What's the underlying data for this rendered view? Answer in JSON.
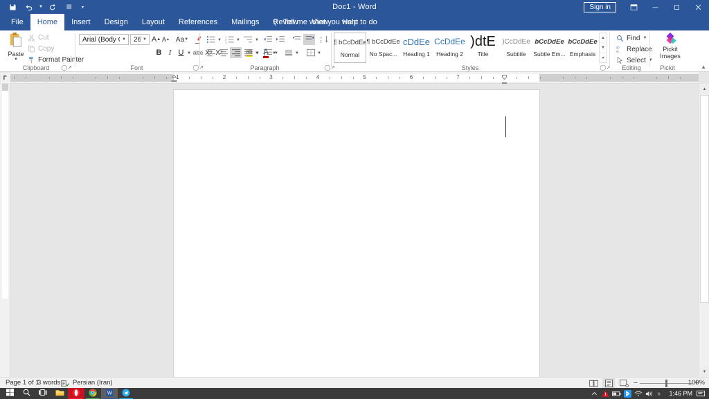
{
  "titlebar": {
    "document_title": "Doc1  -  Word",
    "signin_label": "Sign in",
    "quick_access": [
      {
        "name": "save-icon",
        "tip": "Save"
      },
      {
        "name": "undo-icon",
        "tip": "Undo"
      },
      {
        "name": "redo-icon",
        "tip": "Redo"
      },
      {
        "name": "touch-mode-icon",
        "tip": "Touch/Mouse Mode"
      },
      {
        "name": "customize-qat-icon",
        "tip": "Customize Quick Access Toolbar"
      }
    ],
    "window_buttons": [
      {
        "name": "ribbon-display-options-icon",
        "glyph": "⬚"
      },
      {
        "name": "minimize-icon",
        "glyph": "─"
      },
      {
        "name": "restore-icon",
        "glyph": "❐"
      },
      {
        "name": "close-icon",
        "glyph": "✕"
      }
    ],
    "share_label": "Share"
  },
  "ribbon": {
    "tabs": [
      {
        "label": "File",
        "active": false
      },
      {
        "label": "Home",
        "active": true
      },
      {
        "label": "Insert",
        "active": false
      },
      {
        "label": "Design",
        "active": false
      },
      {
        "label": "Layout",
        "active": false
      },
      {
        "label": "References",
        "active": false
      },
      {
        "label": "Mailings",
        "active": false
      },
      {
        "label": "Review",
        "active": false
      },
      {
        "label": "View",
        "active": false
      },
      {
        "label": "Help",
        "active": false
      }
    ],
    "tell_me": "Tell me what you want to do",
    "groups": {
      "clipboard": {
        "label": "Clipboard",
        "paste_label": "Paste",
        "items": [
          {
            "label": "Cut",
            "icon": "scissors-icon",
            "disabled": true
          },
          {
            "label": "Copy",
            "icon": "copy-icon",
            "disabled": true
          },
          {
            "label": "Format Painter",
            "icon": "format-painter-icon",
            "disabled": false
          }
        ]
      },
      "font": {
        "label": "Font",
        "font_name": "Arial (Body CS)",
        "font_size": "26",
        "row1": [
          {
            "name": "grow-font-button",
            "label": "A"
          },
          {
            "name": "shrink-font-button",
            "label": "A"
          },
          {
            "name": "change-case-button",
            "label": "Aa"
          },
          {
            "name": "clear-formatting-button",
            "label": "clear-formatting-icon"
          }
        ],
        "row2": [
          {
            "name": "bold-button",
            "label": "B"
          },
          {
            "name": "italic-button",
            "label": "I"
          },
          {
            "name": "underline-button",
            "label": "U"
          },
          {
            "name": "strikethrough-button",
            "label": "abc"
          },
          {
            "name": "subscript-button",
            "label": "X₂"
          },
          {
            "name": "superscript-button",
            "label": "X²"
          },
          {
            "name": "text-effects-button",
            "label": "A"
          },
          {
            "name": "text-highlight-color-button",
            "label": "ab"
          },
          {
            "name": "font-color-button",
            "label": "A"
          }
        ]
      },
      "paragraph": {
        "label": "Paragraph",
        "row1": [
          {
            "name": "bullets-button",
            "icon": "bullet-list-icon"
          },
          {
            "name": "numbering-button",
            "icon": "numbered-list-icon"
          },
          {
            "name": "multilevel-list-button",
            "icon": "multilevel-list-icon"
          },
          {
            "name": "decrease-indent-button",
            "icon": "decrease-indent-icon"
          },
          {
            "name": "increase-indent-button",
            "icon": "increase-indent-icon"
          },
          {
            "name": "ltr-text-direction-button",
            "icon": "ltr-icon",
            "active": false
          },
          {
            "name": "rtl-text-direction-button",
            "icon": "rtl-icon",
            "active": true
          },
          {
            "name": "sort-button",
            "icon": "sort-az-icon"
          },
          {
            "name": "show-formatting-marks-button",
            "icon": "pilcrow-icon"
          }
        ],
        "row2": [
          {
            "name": "align-left-button",
            "icon": "align-left-icon",
            "active": false
          },
          {
            "name": "align-center-button",
            "icon": "align-center-icon",
            "active": false
          },
          {
            "name": "align-right-button",
            "icon": "align-right-icon",
            "active": true
          },
          {
            "name": "justify-button",
            "icon": "justify-icon",
            "active": false
          },
          {
            "name": "line-spacing-button",
            "icon": "line-spacing-icon"
          },
          {
            "name": "shading-button",
            "icon": "shading-icon"
          },
          {
            "name": "borders-button",
            "icon": "borders-icon"
          }
        ]
      },
      "styles": {
        "label": "Styles",
        "items": [
          {
            "name": "Normal",
            "preview": "¶ AaBbCcDdEe",
            "sample": "bCcDdEe",
            "prefix": "¶ ",
            "selected": true,
            "color": "#3a3a3a",
            "size": 9.5,
            "italic": false,
            "bold": false
          },
          {
            "name": "No Spac...",
            "preview": "AaBbCcDdEe",
            "sample": "bCcDdEe",
            "prefix": "¶ ",
            "selected": false,
            "color": "#3a3a3a",
            "size": 9.5,
            "italic": false,
            "bold": false
          },
          {
            "name": "Heading 1",
            "preview": "AaBbCcDdEe",
            "sample": "cDdEe",
            "prefix": "",
            "selected": false,
            "color": "#2e74b5",
            "size": 13,
            "italic": false,
            "bold": false
          },
          {
            "name": "Heading 2",
            "preview": "AaBbCcDdEe",
            "sample": "CcDdEe",
            "prefix": "",
            "selected": false,
            "color": "#2e74b5",
            "size": 12,
            "italic": false,
            "bold": false
          },
          {
            "name": "Title",
            "preview": "AaBbCcDdEe",
            "sample": ")dtE",
            "prefix": "",
            "selected": false,
            "color": "#1a1a1a",
            "size": 20,
            "italic": false,
            "bold": false
          },
          {
            "name": "Subtitle",
            "preview": "AaBbCcDdEe",
            "sample": ")CcDdEe",
            "prefix": "",
            "selected": false,
            "color": "#8a8a8a",
            "size": 10,
            "italic": false,
            "bold": false
          },
          {
            "name": "Subtle Em...",
            "preview": "AaBbCcDdEe",
            "sample": "bCcDdEe",
            "prefix": "",
            "selected": false,
            "color": "#3a3a3a",
            "size": 9.5,
            "italic": true,
            "bold": true
          },
          {
            "name": "Emphasis",
            "preview": "AaBbCcDdEe",
            "sample": "bCcDdEe",
            "prefix": "",
            "selected": false,
            "color": "#3a3a3a",
            "size": 9.5,
            "italic": true,
            "bold": true
          }
        ]
      },
      "editing": {
        "label": "Editing",
        "items": [
          {
            "label": "Find",
            "icon": "search-icon",
            "has_caret": true
          },
          {
            "label": "Replace",
            "icon": "replace-icon",
            "has_caret": false
          },
          {
            "label": "Select",
            "icon": "select-icon",
            "has_caret": true
          }
        ]
      },
      "pickit": {
        "label": "Pickit",
        "button_line1": "Pickit",
        "button_line2": "Images"
      }
    }
  },
  "ruler": {
    "numbers": [
      "7",
      "6",
      "5",
      "4",
      "3",
      "2",
      "1"
    ],
    "unit": "inches",
    "direction": "rtl"
  },
  "statusbar": {
    "page": "Page 1 of 1",
    "words": "3 words",
    "proofing_icon": "proofing-errors-icon",
    "language": "Persian (Iran)",
    "views": [
      {
        "name": "read-mode-button",
        "icon": "read-mode-icon",
        "selected": false
      },
      {
        "name": "print-layout-button",
        "icon": "print-layout-icon",
        "selected": true
      },
      {
        "name": "web-layout-button",
        "icon": "web-layout-icon",
        "selected": false
      }
    ],
    "zoom_out": "−",
    "zoom_in": "+",
    "zoom_level": "100%"
  },
  "taskbar": {
    "items": [
      {
        "name": "start-button",
        "icon": "windows-logo-icon",
        "accent": "#ffffff",
        "active": false,
        "running": false
      },
      {
        "name": "search-button",
        "icon": "search-icon",
        "accent": "#ffffff",
        "active": false,
        "running": false
      },
      {
        "name": "task-view-button",
        "icon": "task-view-icon",
        "accent": "#ffffff",
        "active": false,
        "running": false
      },
      {
        "name": "file-explorer-button",
        "icon": "folder-icon",
        "accent": "#ffc83d",
        "active": false,
        "running": false
      },
      {
        "name": "opera-button",
        "icon": "opera-icon",
        "accent": "#ff1b2d",
        "active": true,
        "running": true
      },
      {
        "name": "chrome-button",
        "icon": "chrome-icon",
        "accent": "#4caf50",
        "active": false,
        "running": true
      },
      {
        "name": "word-button",
        "icon": "word-icon",
        "accent": "#2b579a",
        "active": true,
        "running": true
      },
      {
        "name": "telegram-button",
        "icon": "telegram-icon",
        "accent": "#2aabee",
        "active": false,
        "running": true
      }
    ],
    "tray": [
      {
        "name": "show-hidden-icons-button",
        "icon": "chevron-up-icon",
        "color": "#e6e6e6"
      },
      {
        "name": "warning-tray-icon",
        "icon": "warning-icon",
        "color": "#e81123"
      },
      {
        "name": "battery-tray-icon",
        "icon": "battery-icon",
        "color": "#e6e6e6"
      },
      {
        "name": "bluetooth-tray-icon",
        "icon": "bluetooth-icon",
        "color": "#2196f3"
      },
      {
        "name": "network-tray-icon",
        "icon": "wifi-icon",
        "color": "#e6e6e6"
      },
      {
        "name": "volume-tray-icon",
        "icon": "speaker-icon",
        "color": "#e6e6e6"
      },
      {
        "name": "language-tray-icon",
        "icon": "keyboard-layout-icon",
        "color": "#e6e6e6"
      }
    ],
    "clock": "1:46 PM",
    "notifications_icon": "notification-center-icon"
  }
}
